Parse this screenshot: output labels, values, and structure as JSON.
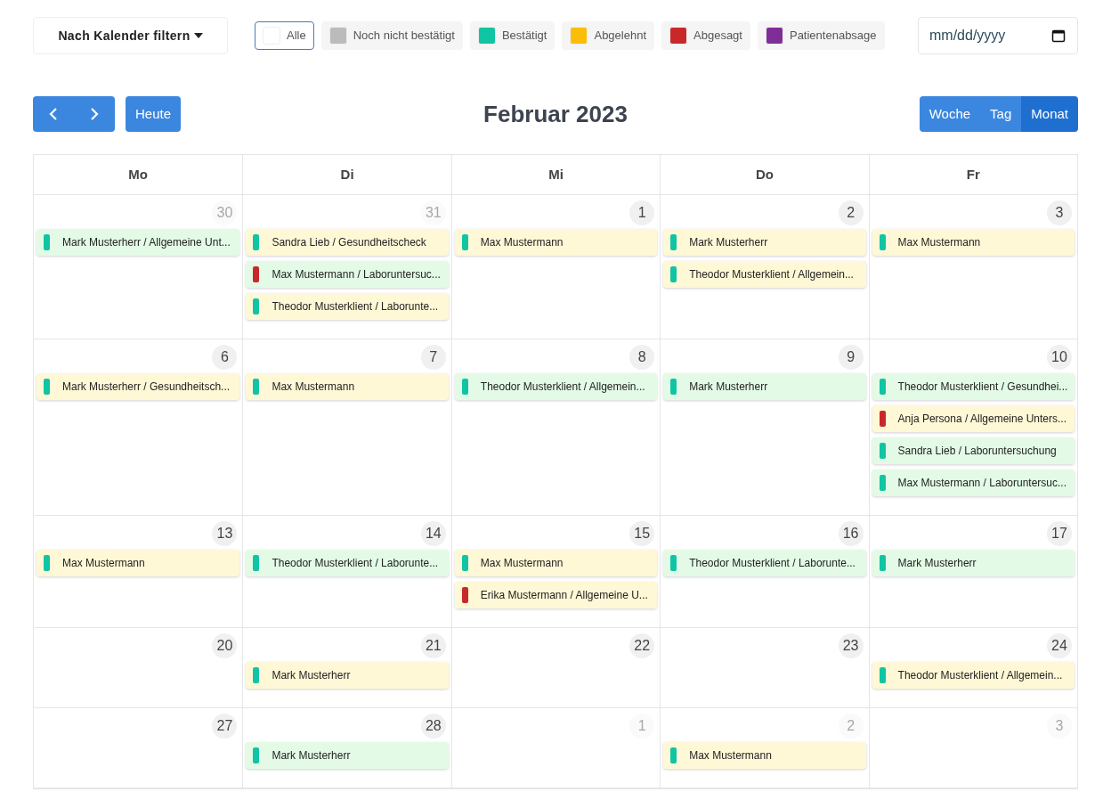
{
  "filter_dropdown": {
    "label": "Nach Kalender filtern"
  },
  "legend": [
    {
      "label": "Alle",
      "color": "#ffffff",
      "selected": true
    },
    {
      "label": "Noch nicht bestätigt",
      "color": "#bbbbbb",
      "selected": false
    },
    {
      "label": "Bestätigt",
      "color": "#10c4a4",
      "selected": false
    },
    {
      "label": "Abgelehnt",
      "color": "#fbbd08",
      "selected": false
    },
    {
      "label": "Abgesagt",
      "color": "#c9282a",
      "selected": false
    },
    {
      "label": "Patientenabsage",
      "color": "#7f2e97",
      "selected": false
    }
  ],
  "date_field": {
    "placeholder": "mm/dd/yyyy"
  },
  "today_button": "Heute",
  "title": "Februar 2023",
  "views": [
    {
      "label": "Woche",
      "selected": false
    },
    {
      "label": "Tag",
      "selected": false
    },
    {
      "label": "Monat",
      "selected": true
    }
  ],
  "weekdays": [
    "Mo",
    "Di",
    "Mi",
    "Do",
    "Fr"
  ],
  "weeks": [
    {
      "days": [
        {
          "number": "30",
          "muted": true,
          "events": [
            {
              "text": "Mark Musterherr / Allgemeine Unt...",
              "color": "#10c4a4",
              "kind": "mint"
            }
          ]
        },
        {
          "number": "31",
          "muted": true,
          "events": [
            {
              "text": "Sandra Lieb / Gesundheitscheck",
              "color": "#10c4a4",
              "kind": "cream"
            },
            {
              "text": "Max Mustermann / Laboruntersuc...",
              "color": "#c9282a",
              "kind": "mint"
            },
            {
              "text": "Theodor Musterklient / Laborunte...",
              "color": "#10c4a4",
              "kind": "cream"
            }
          ]
        },
        {
          "number": "1",
          "muted": false,
          "events": [
            {
              "text": "Max Mustermann",
              "color": "#10c4a4",
              "kind": "cream"
            }
          ]
        },
        {
          "number": "2",
          "muted": false,
          "events": [
            {
              "text": "Mark Musterherr",
              "color": "#10c4a4",
              "kind": "cream"
            },
            {
              "text": "Theodor Musterklient / Allgemein...",
              "color": "#10c4a4",
              "kind": "cream"
            }
          ]
        },
        {
          "number": "3",
          "muted": false,
          "events": [
            {
              "text": "Max Mustermann",
              "color": "#10c4a4",
              "kind": "cream"
            }
          ]
        }
      ]
    },
    {
      "days": [
        {
          "number": "6",
          "muted": false,
          "events": [
            {
              "text": "Mark Musterherr / Gesundheitsch...",
              "color": "#10c4a4",
              "kind": "cream"
            }
          ]
        },
        {
          "number": "7",
          "muted": false,
          "events": [
            {
              "text": "Max Mustermann",
              "color": "#10c4a4",
              "kind": "cream"
            }
          ]
        },
        {
          "number": "8",
          "muted": false,
          "events": [
            {
              "text": "Theodor Musterklient / Allgemein...",
              "color": "#10c4a4",
              "kind": "mint"
            }
          ]
        },
        {
          "number": "9",
          "muted": false,
          "events": [
            {
              "text": "Mark Musterherr",
              "color": "#10c4a4",
              "kind": "mint"
            }
          ]
        },
        {
          "number": "10",
          "muted": false,
          "events": [
            {
              "text": "Theodor Musterklient / Gesundhei...",
              "color": "#10c4a4",
              "kind": "mint"
            },
            {
              "text": "Anja Persona / Allgemeine Unters...",
              "color": "#c9282a",
              "kind": "cream"
            },
            {
              "text": "Sandra Lieb / Laboruntersuchung",
              "color": "#10c4a4",
              "kind": "mint"
            },
            {
              "text": "Max Mustermann / Laboruntersuc...",
              "color": "#10c4a4",
              "kind": "mint"
            }
          ]
        }
      ]
    },
    {
      "days": [
        {
          "number": "13",
          "muted": false,
          "events": [
            {
              "text": "Max Mustermann",
              "color": "#10c4a4",
              "kind": "cream"
            }
          ]
        },
        {
          "number": "14",
          "muted": false,
          "events": [
            {
              "text": "Theodor Musterklient / Laborunte...",
              "color": "#10c4a4",
              "kind": "mint"
            }
          ]
        },
        {
          "number": "15",
          "muted": false,
          "events": [
            {
              "text": "Max Mustermann",
              "color": "#10c4a4",
              "kind": "cream"
            },
            {
              "text": "Erika Mustermann / Allgemeine U...",
              "color": "#c9282a",
              "kind": "cream"
            }
          ]
        },
        {
          "number": "16",
          "muted": false,
          "events": [
            {
              "text": "Theodor Musterklient / Laborunte...",
              "color": "#10c4a4",
              "kind": "mint"
            }
          ]
        },
        {
          "number": "17",
          "muted": false,
          "events": [
            {
              "text": "Mark Musterherr",
              "color": "#10c4a4",
              "kind": "mint"
            }
          ]
        }
      ]
    },
    {
      "days": [
        {
          "number": "20",
          "muted": false
        },
        {
          "number": "21",
          "muted": false,
          "events": [
            {
              "text": "Mark Musterherr",
              "color": "#10c4a4",
              "kind": "cream"
            }
          ]
        },
        {
          "number": "22",
          "muted": false
        },
        {
          "number": "23",
          "muted": false
        },
        {
          "number": "24",
          "muted": false,
          "events": [
            {
              "text": "Theodor Musterklient / Allgemein...",
              "color": "#10c4a4",
              "kind": "cream"
            }
          ]
        }
      ]
    },
    {
      "days": [
        {
          "number": "27",
          "muted": false
        },
        {
          "number": "28",
          "muted": false,
          "events": [
            {
              "text": "Mark Musterherr",
              "color": "#10c4a4",
              "kind": "mint"
            }
          ]
        },
        {
          "number": "1",
          "muted": true
        },
        {
          "number": "2",
          "muted": true,
          "events": [
            {
              "text": "Max Mustermann",
              "color": "#10c4a4",
              "kind": "cream"
            }
          ]
        },
        {
          "number": "3",
          "muted": true
        }
      ]
    }
  ]
}
